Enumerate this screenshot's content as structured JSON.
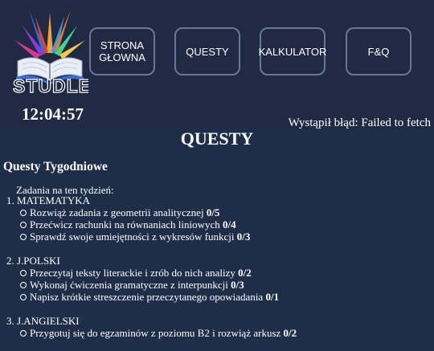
{
  "header": {
    "logo_text": "STUDLER",
    "nav": [
      {
        "label": "STRONA\nGŁOWNA"
      },
      {
        "label": "QUESTY"
      },
      {
        "label": "KALKULATOR"
      },
      {
        "label": "F&Q"
      }
    ],
    "clock": "12:04:57",
    "error": "Wystąpił błąd: Failed to fetch"
  },
  "main": {
    "title": "QUESTY",
    "section_title": "Questy Tygodniowe",
    "intro": "Zadania na ten tydzień:",
    "subjects": [
      {
        "name": "1. MATEMATYKA",
        "tasks": [
          {
            "text": "Rozwiąż zadania z geometrii analitycznej",
            "progress": "0/5"
          },
          {
            "text": "Przećwicz rachunki na równaniach liniowych",
            "progress": "0/4"
          },
          {
            "text": "Sprawdź swoje umiejętności z wykresów funkcji",
            "progress": "0/3"
          }
        ]
      },
      {
        "name": "2. J.POLSKI",
        "tasks": [
          {
            "text": "Przeczytaj teksty literackie i zrób do nich analizy",
            "progress": "0/2"
          },
          {
            "text": "Wykonaj ćwiczenia gramatyczne z interpunkcji",
            "progress": "0/3"
          },
          {
            "text": "Napisz krótkie streszczenie przeczytanego opowiadania",
            "progress": "0/1"
          }
        ]
      },
      {
        "name": "3. J.ANGIELSKI",
        "tasks": [
          {
            "text": "Przygotuj się do egzaminów z poziomu B2 i rozwiąż arkusz",
            "progress": "0/2"
          }
        ]
      }
    ]
  },
  "colors": {
    "background": "#1f2e48",
    "header_background": "#202a42",
    "button_border": "#6a7696"
  }
}
